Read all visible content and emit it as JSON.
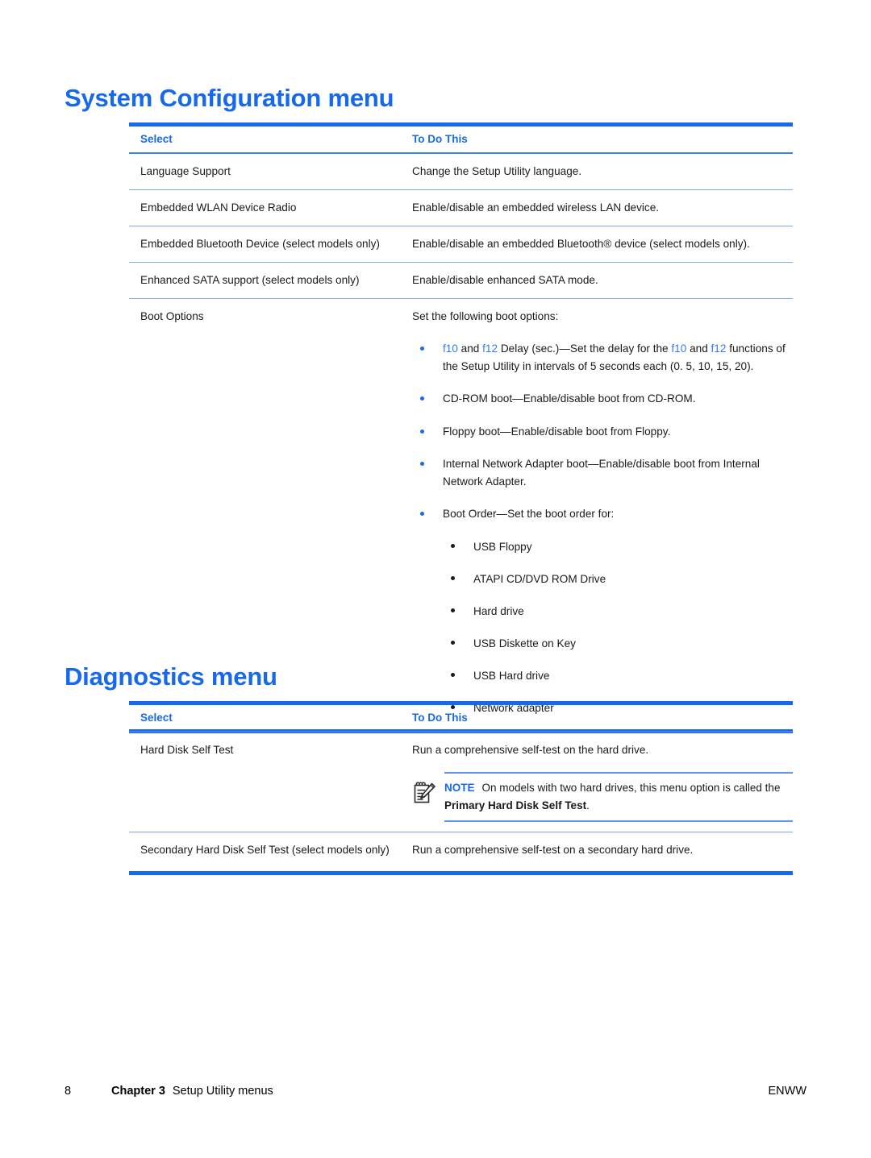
{
  "sections": [
    {
      "title": "System Configuration menu",
      "columns": {
        "select": "Select",
        "todo": "To Do This"
      },
      "rows": [
        {
          "select": "Language Support",
          "todo": "Change the Setup Utility language."
        },
        {
          "select": "Embedded WLAN Device Radio",
          "todo": "Enable/disable an embedded wireless LAN device."
        },
        {
          "select": "Embedded Bluetooth Device (select models only)",
          "todo": "Enable/disable an embedded Bluetooth® device (select models only)."
        },
        {
          "select": "Enhanced SATA support (select models only)",
          "todo": "Enable/disable enhanced SATA mode."
        },
        {
          "select": "Boot Options",
          "todo": "Set the following boot options:"
        }
      ],
      "boot_options": {
        "delay": {
          "key1": "f10",
          "and1": " and ",
          "key2": "f12",
          "mid": " Delay (sec.)—Set the delay for the ",
          "key3": "f10",
          "and2": " and ",
          "key4": "f12",
          "tail": " functions of the Setup Utility in intervals of 5 seconds each (0. 5, 10, 15, 20)."
        },
        "cdrom": "CD-ROM boot—Enable/disable boot from CD-ROM.",
        "floppy": "Floppy boot—Enable/disable boot from Floppy.",
        "network": "Internal Network Adapter boot—Enable/disable boot from Internal Network Adapter.",
        "boot_order_label": "Boot Order—Set the boot order for:",
        "boot_order_items": [
          "USB Floppy",
          "ATAPI CD/DVD ROM Drive",
          "Hard drive",
          "USB Diskette on Key",
          "USB Hard drive",
          "Network adapter"
        ]
      }
    },
    {
      "title": "Diagnostics menu",
      "columns": {
        "select": "Select",
        "todo": "To Do This"
      },
      "rows": [
        {
          "select": "Hard Disk Self Test",
          "todo": "Run a comprehensive self-test on the hard drive."
        },
        {
          "select": "Secondary Hard Disk Self Test (select models only)",
          "todo": "Run a comprehensive self-test on a secondary hard drive."
        }
      ],
      "note": {
        "label": "NOTE",
        "text_before": "On models with two hard drives, this menu option is called the ",
        "text_bold": "Primary Hard Disk Self Test",
        "text_after": "."
      }
    }
  ],
  "footer": {
    "page_number": "8",
    "chapter": "Chapter 3",
    "chapter_title": "Setup Utility menus",
    "locale": "ENWW"
  },
  "colors": {
    "heading_blue": "#1769ec",
    "rule_blue": "#1769ec",
    "rule_light": "#7aaaf3",
    "keyword_blue": "#2f7cf0"
  }
}
